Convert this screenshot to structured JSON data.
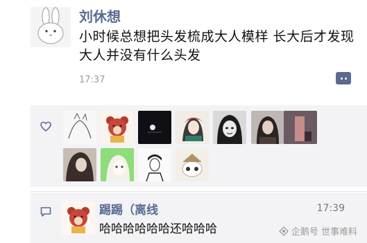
{
  "post": {
    "author": "刘休想",
    "text": "小时候总想把头发梳成大人模样 长大后才发现 大人并没有什么头发",
    "time": "17:37"
  },
  "likes": {
    "thumbnails": [
      {
        "name": "like-avatar-sketch-cat"
      },
      {
        "name": "like-avatar-bear"
      },
      {
        "name": "like-avatar-dark"
      },
      {
        "name": "like-avatar-anime-red"
      },
      {
        "name": "like-avatar-anime-bw"
      },
      {
        "name": "like-avatar-girl-photo"
      },
      {
        "name": "like-avatar-girl-dark"
      },
      {
        "name": "like-avatar-girl-hair"
      },
      {
        "name": "like-avatar-green-anime"
      },
      {
        "name": "like-avatar-boy-sketch"
      },
      {
        "name": "like-avatar-cat-hat"
      }
    ]
  },
  "comment": {
    "author": "踢踢（离线",
    "time": "17:39",
    "text": "哈哈哈哈哈哈还哈哈哈"
  },
  "watermark": {
    "text": "企鹅号 世事难料"
  },
  "colors": {
    "name_blue": "#5b6a92",
    "panel_bg": "#f3f3f5"
  }
}
